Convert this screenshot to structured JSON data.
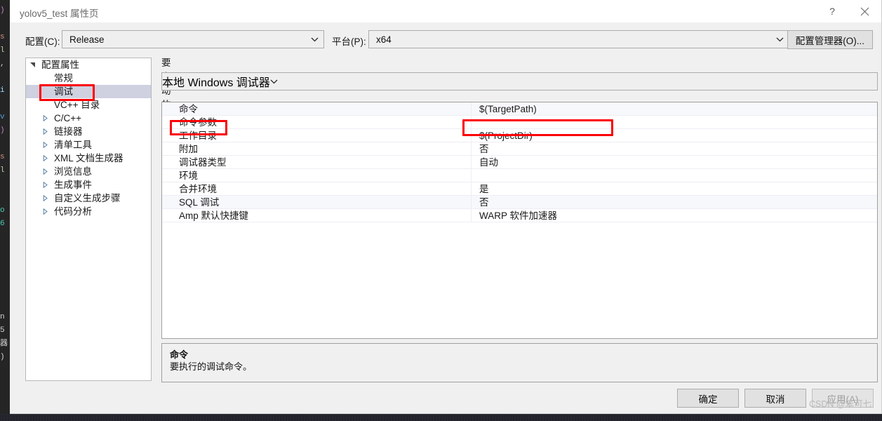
{
  "window": {
    "title": "yolov5_test 属性页",
    "help_icon": "question-mark-icon",
    "close_icon": "close-icon"
  },
  "config_bar": {
    "config_label": "配置(C):",
    "config_value": "Release",
    "platform_label": "平台(P):",
    "platform_value": "x64",
    "config_manager_button": "配置管理器(O)...",
    "dropdown_icon": "chevron-down-icon"
  },
  "tree": {
    "items": [
      {
        "label": "配置属性",
        "level": 0,
        "twisty": "expanded",
        "selected": false
      },
      {
        "label": "常规",
        "level": 1,
        "twisty": "none",
        "selected": false
      },
      {
        "label": "调试",
        "level": 1,
        "twisty": "none",
        "selected": true
      },
      {
        "label": "VC++ 目录",
        "level": 1,
        "twisty": "none",
        "selected": false
      },
      {
        "label": "C/C++",
        "level": 1,
        "twisty": "collapsed",
        "selected": false
      },
      {
        "label": "链接器",
        "level": 1,
        "twisty": "collapsed",
        "selected": false
      },
      {
        "label": "清单工具",
        "level": 1,
        "twisty": "collapsed",
        "selected": false
      },
      {
        "label": "XML 文档生成器",
        "level": 1,
        "twisty": "collapsed",
        "selected": false
      },
      {
        "label": "浏览信息",
        "level": 1,
        "twisty": "collapsed",
        "selected": false
      },
      {
        "label": "生成事件",
        "level": 1,
        "twisty": "collapsed",
        "selected": false
      },
      {
        "label": "自定义生成步骤",
        "level": 1,
        "twisty": "collapsed",
        "selected": false
      },
      {
        "label": "代码分析",
        "level": 1,
        "twisty": "collapsed",
        "selected": false
      }
    ]
  },
  "main": {
    "launch_label": "要启动的调试器:",
    "debugger_value": "本地 Windows 调试器",
    "rows": [
      {
        "name": "命令",
        "value": "$(TargetPath)",
        "alt": true
      },
      {
        "name": "命令参数",
        "value": "",
        "alt": false
      },
      {
        "name": "工作目录",
        "value": "$(ProjectDir)",
        "alt": false
      },
      {
        "name": "附加",
        "value": "否",
        "alt": false
      },
      {
        "name": "调试器类型",
        "value": "自动",
        "alt": false
      },
      {
        "name": "环境",
        "value": "",
        "alt": false
      },
      {
        "name": "合并环境",
        "value": "是",
        "alt": false
      },
      {
        "name": "SQL 调试",
        "value": "否",
        "alt": true
      },
      {
        "name": "Amp 默认快捷键",
        "value": "WARP 软件加速器",
        "alt": false
      }
    ]
  },
  "description": {
    "title": "命令",
    "body": "要执行的调试命令。"
  },
  "footer": {
    "ok": "确定",
    "cancel": "取消",
    "apply": "应用(A)"
  },
  "watermark": "CSDN @笨可七",
  "annotations": {
    "highlight_color": "#fb0007",
    "boxes": [
      "调试",
      "命令参数",
      "命令参数-value-field"
    ]
  }
}
